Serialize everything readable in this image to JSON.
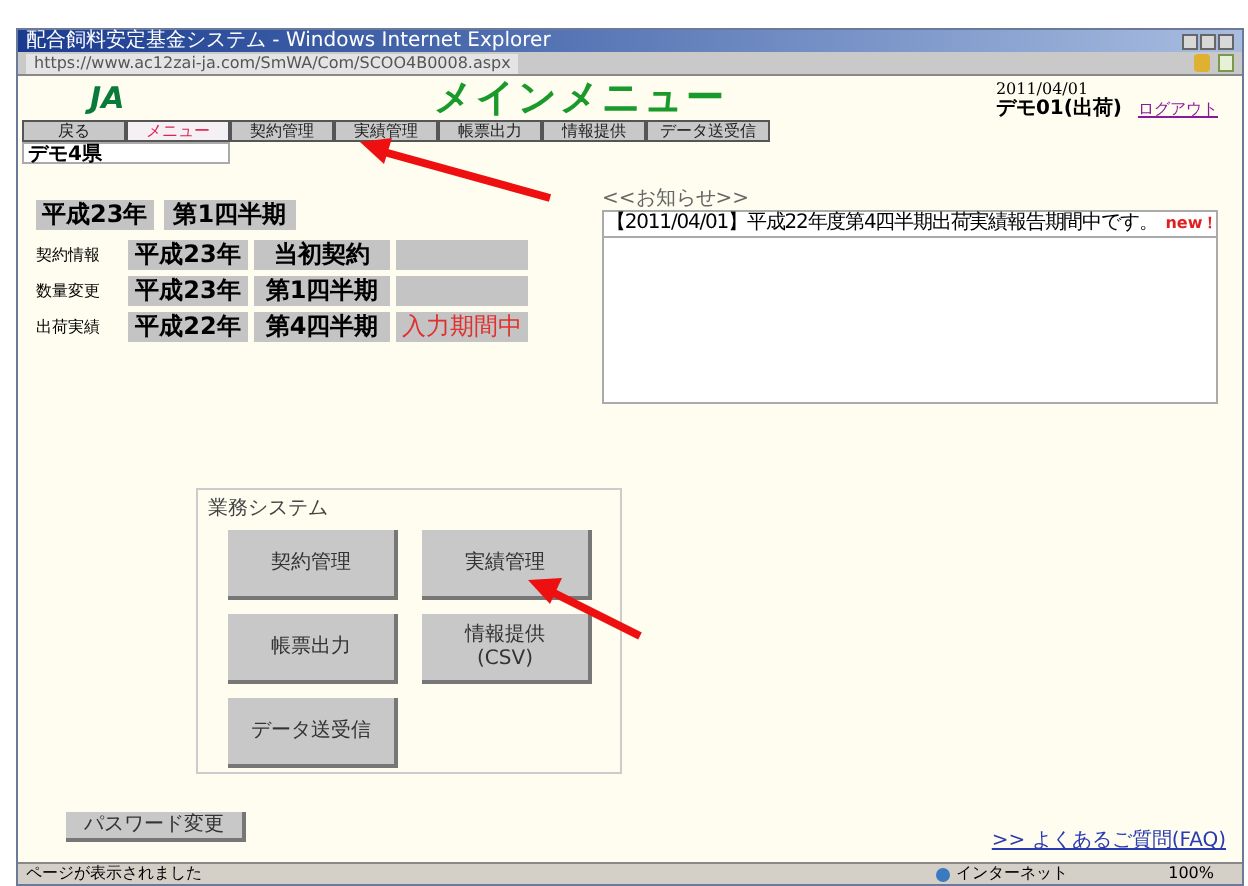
{
  "window": {
    "title": "配合飼料安定基金システム - Windows Internet Explorer",
    "address": "https://www.ac12zai-ja.com/SmWA/Com/SCOO4B0008.aspx"
  },
  "header": {
    "logo": "JA",
    "title": "メインメニュー",
    "date": "2011/04/01",
    "user": "デモ01(出荷)",
    "logout": "ログアウト"
  },
  "nav": [
    {
      "label": "戻る",
      "selected": false
    },
    {
      "label": "メニュー",
      "selected": true
    },
    {
      "label": "契約管理",
      "selected": false
    },
    {
      "label": "実績管理",
      "selected": false
    },
    {
      "label": "帳票出力",
      "selected": false
    },
    {
      "label": "情報提供",
      "selected": false
    },
    {
      "label": "データ送受信",
      "selected": false
    }
  ],
  "prefecture": "デモ4県",
  "period": {
    "year": "平成23年",
    "quarter": "第1四半期"
  },
  "status_rows": [
    {
      "label": "契約情報",
      "year": "平成23年",
      "term": "当初契約",
      "state": "",
      "alert": false
    },
    {
      "label": "数量変更",
      "year": "平成23年",
      "term": "第1四半期",
      "state": "",
      "alert": false
    },
    {
      "label": "出荷実績",
      "year": "平成22年",
      "term": "第4四半期",
      "state": "入力期間中",
      "alert": true
    }
  ],
  "notices": {
    "title": "<<お知らせ>>",
    "items": [
      {
        "text": "【2011/04/01】平成22年度第4四半期出荷実績報告期間中です。",
        "badge": "new！"
      }
    ]
  },
  "business": {
    "title": "業務システム",
    "buttons": [
      {
        "label": "契約管理"
      },
      {
        "label": "実績管理"
      },
      {
        "label": "帳票出力"
      },
      {
        "label": "情報提供\n(CSV)"
      },
      {
        "label": "データ送受信"
      }
    ]
  },
  "password_button": "パスワード変更",
  "faq_link": ">> よくあるご質問(FAQ)",
  "status_bar": {
    "text": "ページが表示されました",
    "zone": "インターネット",
    "zoom": "100%"
  }
}
